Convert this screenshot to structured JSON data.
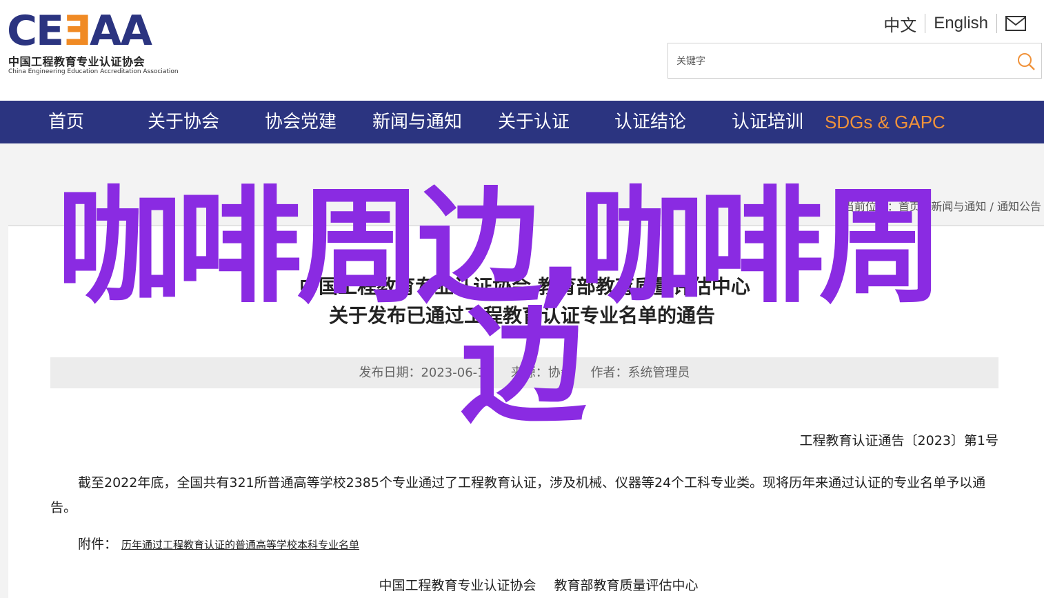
{
  "header": {
    "logo_main": "CE",
    "logo_accent": "Ǝ",
    "logo_tail": "AA",
    "logo_cn": "中国工程教育专业认证协会",
    "logo_en": "China Engineering Education Accreditation Association",
    "lang_cn": "中文",
    "lang_en": "English",
    "mail_icon": "mail-icon"
  },
  "search": {
    "placeholder": "关键字",
    "icon": "search-icon",
    "icon_color": "#f0923a"
  },
  "nav": {
    "items": [
      {
        "label": "首页"
      },
      {
        "label": "关于协会"
      },
      {
        "label": "协会党建"
      },
      {
        "label": "新闻与通知"
      },
      {
        "label": "关于认证"
      },
      {
        "label": "认证结论"
      },
      {
        "label": "认证培训"
      },
      {
        "label": "SDGs & GAPC"
      }
    ],
    "background": "#2b3480",
    "highlight_color": "#f0923a"
  },
  "breadcrumb": {
    "prefix": "当前位置：",
    "items": [
      "首页",
      "新闻与通知",
      "通知公告"
    ],
    "separator": " / "
  },
  "article": {
    "title_line1": "中国工程教育专业认证协会 教育部教育质量评估中心",
    "title_line2": "关于发布已通过工程教育认证专业名单的通告",
    "meta_date": "发布日期：2023-06-13",
    "meta_source": "来源：协会",
    "meta_author": "作者：系统管理员",
    "doc_no": "工程教育认证通告〔2023〕第1号",
    "paragraph": "截至2022年底，全国共有321所普通高等学校2385个专业通过了工程教育认证，涉及机械、仪器等24个工科专业类。现将历年来通过认证的专业名单予以通告。",
    "attach_label": "附件：",
    "attach_link": "历年通过工程教育认证的普通高等学校本科专业名单",
    "signer1": "中国工程教育专业认证协会",
    "signer2": "教育部教育质量评估中心"
  },
  "overlay": {
    "line1": "咖啡周边,咖啡周",
    "line2": "边",
    "color": "#8a2be2"
  }
}
